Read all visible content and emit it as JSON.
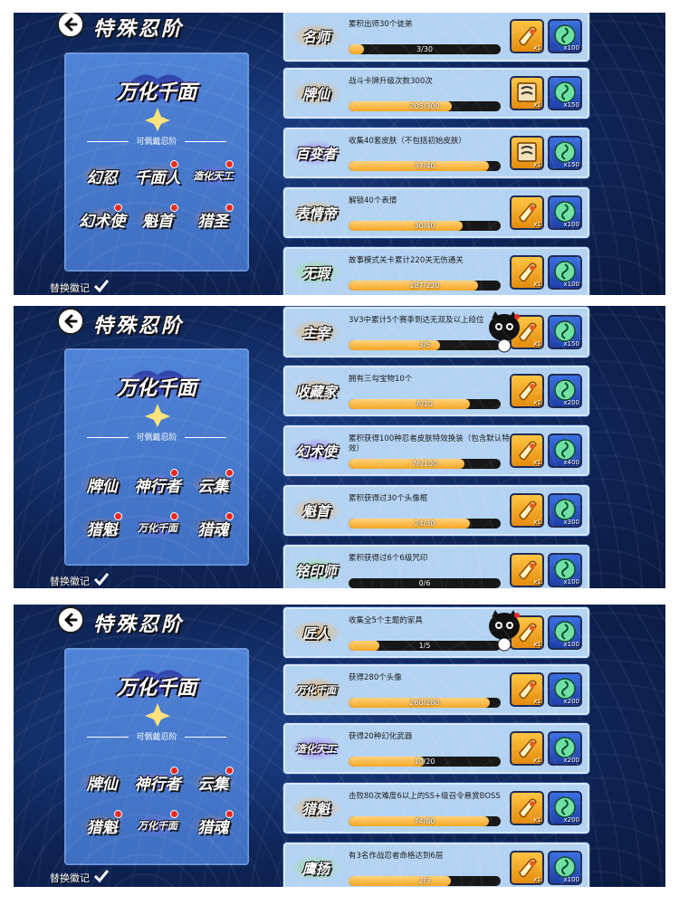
{
  "shots": [
    {
      "title": "特殊忍阶",
      "panel": {
        "emblem_title": "万化千面",
        "section_label": "可佩戴忍阶",
        "badges": [
          {
            "label": "幻忍",
            "dot": false,
            "style": "warm"
          },
          {
            "label": "千面人",
            "dot": true,
            "style": "warm"
          },
          {
            "label": "造化天工",
            "dot": true,
            "style": "purple"
          },
          {
            "label": "幻术使",
            "dot": true,
            "style": "warm"
          },
          {
            "label": "魁首",
            "dot": true,
            "style": "warm"
          },
          {
            "label": "猎圣",
            "dot": true,
            "style": "warm"
          }
        ]
      },
      "replace_label": "替换徽记",
      "tasks": [
        {
          "badge": "名师",
          "text": "累积出师30个徒弟",
          "progress_text": "3/30",
          "progress": 0.1,
          "reward1": {
            "icon": "scroll-icon",
            "count": "x1"
          },
          "reward2": {
            "icon": "green-orb-icon",
            "count": "x100"
          }
        },
        {
          "badge": "牌仙",
          "text": "战斗卡牌升级次数300次",
          "progress_text": "205/300",
          "progress": 0.68,
          "reward1": {
            "icon": "card-scroll-icon",
            "count": "x1"
          },
          "reward2": {
            "icon": "green-orb-icon",
            "count": "x150"
          }
        },
        {
          "badge": "百变者",
          "text": "收集40套皮肤（不包括初始皮肤）",
          "progress_text": "37/40",
          "progress": 0.92,
          "reward1": {
            "icon": "card-scroll-icon",
            "count": "x1"
          },
          "reward2": {
            "icon": "green-orb-icon",
            "count": "x150"
          }
        },
        {
          "badge": "表情帝",
          "text": "解锁40个表情",
          "progress_text": "30/40",
          "progress": 0.75,
          "reward1": {
            "icon": "scroll-icon",
            "count": "x1"
          },
          "reward2": {
            "icon": "green-orb-icon",
            "count": "x100"
          }
        },
        {
          "badge": "无瑕",
          "text": "故事模式关卡累计220关无伤通关",
          "progress_text": "187/220",
          "progress": 0.85,
          "reward1": {
            "icon": "scroll-icon",
            "count": "x1"
          },
          "reward2": {
            "icon": "green-orb-icon",
            "count": "x100"
          }
        }
      ]
    },
    {
      "title": "特殊忍阶",
      "panel": {
        "emblem_title": "万化千面",
        "section_label": "可佩戴忍阶",
        "badges": [
          {
            "label": "牌仙",
            "dot": false,
            "style": "warm"
          },
          {
            "label": "神行者",
            "dot": true,
            "style": "purple"
          },
          {
            "label": "云集",
            "dot": true,
            "style": "warm"
          },
          {
            "label": "猎魁",
            "dot": true,
            "style": "warm"
          },
          {
            "label": "万化千面",
            "dot": true,
            "style": "purple"
          },
          {
            "label": "猎魂",
            "dot": true,
            "style": "warm"
          }
        ]
      },
      "replace_label": "替换徽记",
      "tasks": [
        {
          "badge": "主宰",
          "text": "3V3中累计5个赛季到达无双及以上段位",
          "progress_text": "3/5",
          "progress": 0.6,
          "reward1": {
            "icon": "scroll-icon",
            "count": "x1"
          },
          "reward2": {
            "icon": "green-orb-icon",
            "count": "x150"
          }
        },
        {
          "badge": "收藏家",
          "text": "拥有三勾宝物10个",
          "progress_text": "8/10",
          "progress": 0.8,
          "reward1": {
            "icon": "scroll-icon",
            "count": "x1"
          },
          "reward2": {
            "icon": "green-orb-icon",
            "count": "x200"
          }
        },
        {
          "badge": "幻术使",
          "text": "累积获得100种忍者皮肤特效换装（包含默认特效）",
          "progress_text": "76/100",
          "progress": 0.76,
          "reward1": {
            "icon": "scroll-icon",
            "count": "x1"
          },
          "reward2": {
            "icon": "green-orb-icon",
            "count": "x400"
          }
        },
        {
          "badge": "魁首",
          "text": "累积获得过30个头像框",
          "progress_text": "24/30",
          "progress": 0.8,
          "reward1": {
            "icon": "scroll-icon",
            "count": "x1"
          },
          "reward2": {
            "icon": "green-orb-icon",
            "count": "x300"
          }
        },
        {
          "badge": "铭印师",
          "text": "累积获得过6个6级咒印",
          "progress_text": "0/6",
          "progress": 0.0,
          "reward1": {
            "icon": "scroll-icon",
            "count": "x1"
          },
          "reward2": {
            "icon": "green-orb-icon",
            "count": "x100"
          }
        }
      ]
    },
    {
      "title": "特殊忍阶",
      "panel": {
        "emblem_title": "万化千面",
        "section_label": "可佩戴忍阶",
        "badges": [
          {
            "label": "牌仙",
            "dot": false,
            "style": "warm"
          },
          {
            "label": "神行者",
            "dot": true,
            "style": "purple"
          },
          {
            "label": "云集",
            "dot": true,
            "style": "warm"
          },
          {
            "label": "猎魁",
            "dot": true,
            "style": "warm"
          },
          {
            "label": "万化千面",
            "dot": true,
            "style": "purple"
          },
          {
            "label": "猎魂",
            "dot": true,
            "style": "warm"
          }
        ]
      },
      "replace_label": "替换徽记",
      "tasks": [
        {
          "badge": "匠人",
          "text": "收集全5个主题的家具",
          "progress_text": "1/5",
          "progress": 0.2,
          "reward1": {
            "icon": "scroll-icon",
            "count": "x1"
          },
          "reward2": {
            "icon": "green-orb-icon",
            "count": "x100"
          }
        },
        {
          "badge": "万化千面",
          "text": "获得280个头像",
          "progress_text": "260/280",
          "progress": 0.93,
          "reward1": {
            "icon": "scroll-icon",
            "count": "x1"
          },
          "reward2": {
            "icon": "green-orb-icon",
            "count": "x200"
          }
        },
        {
          "badge": "造化天工",
          "text": "获得20种幻化武器",
          "progress_text": "10/20",
          "progress": 0.5,
          "reward1": {
            "icon": "scroll-icon",
            "count": "x1"
          },
          "reward2": {
            "icon": "green-orb-icon",
            "count": "x200"
          }
        },
        {
          "badge": "猎魁",
          "text": "击败80次难度6以上的SS+级召令悬赏BOSS",
          "progress_text": "74/80",
          "progress": 0.92,
          "reward1": {
            "icon": "scroll-icon",
            "count": "x1"
          },
          "reward2": {
            "icon": "green-orb-icon",
            "count": "x200"
          }
        },
        {
          "badge": "鹰扬",
          "text": "有3名作战忍者命格达到6层",
          "progress_text": "2/3",
          "progress": 0.67,
          "reward1": {
            "icon": "scroll-icon",
            "count": "x1"
          },
          "reward2": {
            "icon": "green-orb-icon",
            "count": "x100"
          }
        }
      ]
    }
  ],
  "colors": {
    "bar_fill": "#f5a623",
    "row_bg": "#b4d3f2",
    "panel_bg": "#4f83d6",
    "red_dot": "#e8281e"
  }
}
